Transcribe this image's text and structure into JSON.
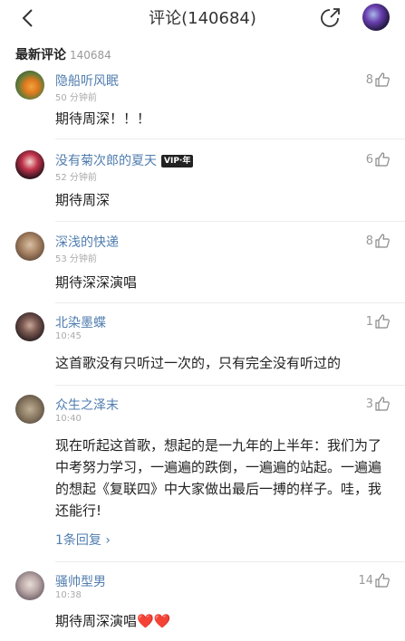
{
  "header": {
    "title": "评论(140684)"
  },
  "section": {
    "label": "最新评论",
    "count": "140684"
  },
  "comments": [
    {
      "user": "隐船听风眠",
      "time": "50 分钟前",
      "likes": "8",
      "text": "期待周深！！！"
    },
    {
      "user": "没有菊次郎的夏天",
      "vip": "VIP·年",
      "time": "52 分钟前",
      "likes": "6",
      "text": "期待周深"
    },
    {
      "user": "深浅的快递",
      "time": "53 分钟前",
      "likes": "8",
      "text": "期待深深演唱"
    },
    {
      "user": "北染墨蝶",
      "time": "10:45",
      "likes": "1",
      "text": "这首歌没有只听过一次的，只有完全没有听过的"
    },
    {
      "user": "众生之泽末",
      "time": "10:40",
      "likes": "3",
      "text": "现在听起这首歌，想起的是一九年的上半年：我们为了中考努力学习，一遍遍的跌倒，一遍遍的站起。一遍遍的想起《复联四》中大家做出最后一搏的样子。哇，我还能行!",
      "replies": "1条回复 ›"
    },
    {
      "user": "骚帅型男",
      "time": "10:38",
      "likes": "14",
      "text": "期待周深演唱",
      "hearts": "❤️❤️"
    }
  ]
}
